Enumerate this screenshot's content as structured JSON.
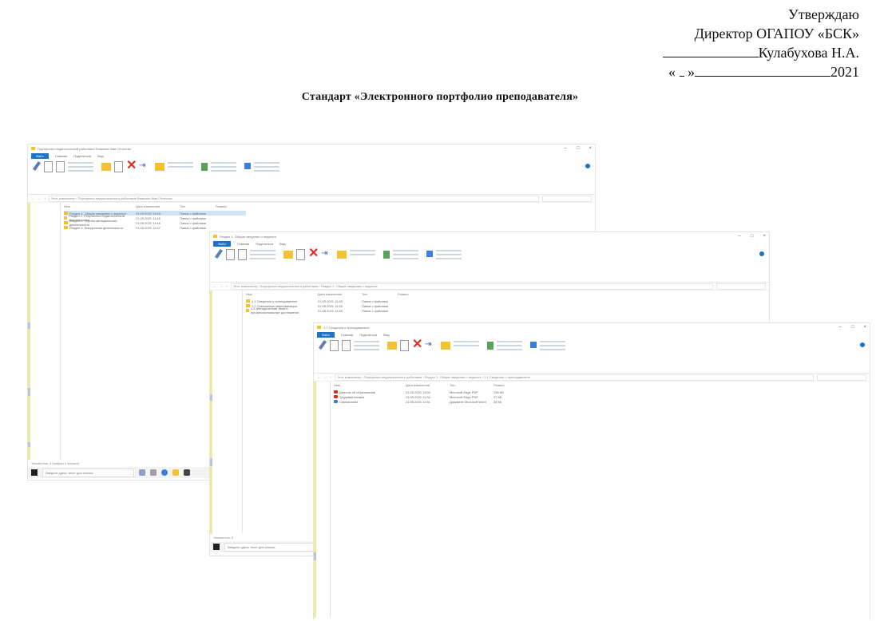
{
  "approval": {
    "line1": "Утверждаю",
    "line2": "Директор ОГАПОУ «БСК»",
    "name": "Кулабухова Н.А.",
    "quote_open": "«",
    "quote_close": "»",
    "year": "2021"
  },
  "document_title": "Стандарт «Электронного портфолио преподавателя»",
  "windows": [
    {
      "title": "Портфолио педагогической работника Фамилия Имя Отчество",
      "menu": [
        "Файл",
        "Главная",
        "Поделиться",
        "Вид"
      ],
      "path": "Этот компьютер › Портфолио педагогического работника Фамилия Имя Отчество",
      "columns": [
        "Имя",
        "Дата изменения",
        "Тип",
        "Размер"
      ],
      "rows": [
        {
          "name": "Раздел 1. Общие сведения о педагоге",
          "date": "21.05.2021 11:45",
          "type": "Папка с файлами",
          "size": "",
          "icon": "folder",
          "selected": true
        },
        {
          "name": "Раздел 2. Результаты педагогической деятельности",
          "date": "21.05.2021 11:46",
          "type": "Папка с файлами",
          "size": "",
          "icon": "folder",
          "selected": false
        },
        {
          "name": "Раздел 3. Научно-методическая деятельность",
          "date": "21.05.2021 11:46",
          "type": "Папка с файлами",
          "size": "",
          "icon": "folder",
          "selected": false
        },
        {
          "name": "Раздел 4. Внеурочная деятельность",
          "date": "21.05.2021 11:47",
          "type": "Папка с файлами",
          "size": "",
          "icon": "folder",
          "selected": false
        }
      ],
      "status": "Элементов: 4   Выбран 1 элемент",
      "search_placeholder": "Введите здесь текст для поиска"
    },
    {
      "title": "Раздел 1. Общие сведения о педагоге",
      "menu": [
        "Файл",
        "Главная",
        "Поделиться",
        "Вид"
      ],
      "path": "Этот компьютер › Портфолио педагогического работника › Раздел 1. Общие сведения о педагоге",
      "columns": [
        "Имя",
        "Дата изменения",
        "Тип",
        "Размер"
      ],
      "rows": [
        {
          "name": "1.1 Сведения о преподавателе",
          "date": "21.05.2021 11:45",
          "type": "Папка с файлами",
          "size": "",
          "icon": "folder",
          "selected": false
        },
        {
          "name": "1.2 Повышение квалификации",
          "date": "21.05.2021 11:45",
          "type": "Папка с файлами",
          "size": "",
          "icon": "folder",
          "selected": false
        },
        {
          "name": "1.3 Методическая тема и профессиональные достижения",
          "date": "21.05.2021 11:46",
          "type": "Папка с файлами",
          "size": "",
          "icon": "folder",
          "selected": false
        }
      ],
      "status": "Элементов: 3",
      "search_placeholder": "Введите здесь текст для поиска"
    },
    {
      "title": "1.1 Сведения о преподавателе",
      "menu": [
        "Файл",
        "Главная",
        "Поделиться",
        "Вид"
      ],
      "path": "Этот компьютер › Портфолио педагогического работника › Раздел 1. Общие сведения о педагоге › 1.1 Сведения о преподавателе",
      "columns": [
        "Имя",
        "Дата изменения",
        "Тип",
        "Размер"
      ],
      "rows": [
        {
          "name": "Диплом об образовании",
          "date": "21.05.2021 11:50",
          "type": "Microsoft Edge PDF",
          "size": "135 КБ",
          "icon": "pdf",
          "selected": false
        },
        {
          "name": "Трудовая книжка",
          "date": "21.05.2021 11:50",
          "type": "Microsoft Edge PDF",
          "size": "97 КБ",
          "icon": "pdf",
          "selected": false
        },
        {
          "name": "Самоанализ",
          "date": "21.05.2021 11:51",
          "type": "Документ Microsoft Word",
          "size": "28 КБ",
          "icon": "word",
          "selected": false
        }
      ],
      "status": "",
      "search_placeholder": ""
    }
  ]
}
